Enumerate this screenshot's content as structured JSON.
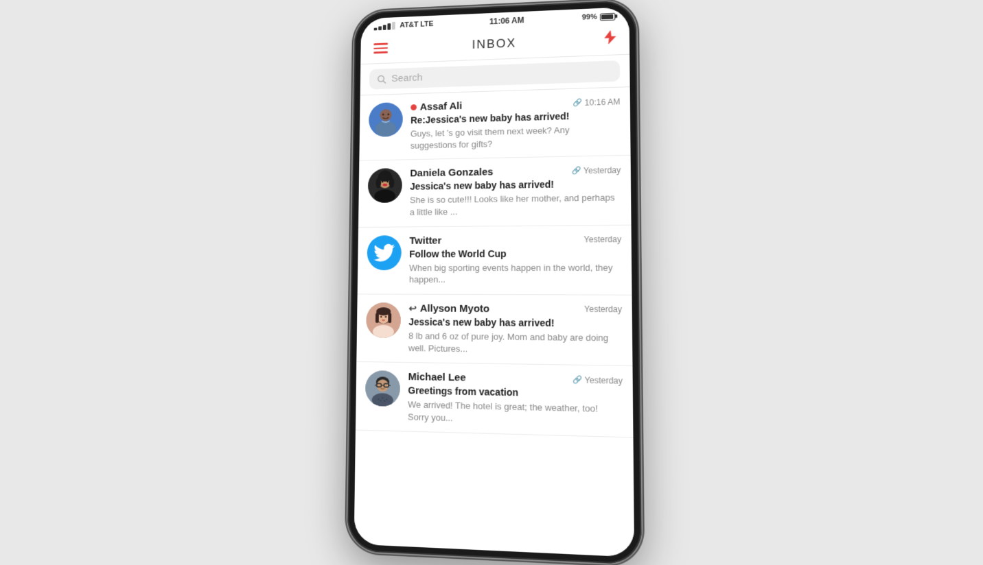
{
  "statusBar": {
    "carrier": "AT&T LTE",
    "time": "11:06 AM",
    "battery": "99%"
  },
  "header": {
    "title": "INBOX",
    "menuLabel": "Menu",
    "composeLabel": "Compose"
  },
  "search": {
    "placeholder": "Search"
  },
  "emails": [
    {
      "id": 1,
      "sender": "Assaf Ali",
      "unread": true,
      "time": "10:16 AM",
      "hasAttachment": true,
      "subject": "Re:Jessica's new baby has arrived!",
      "preview": "Guys, let 's go visit them next week? Any suggestions for gifts?",
      "avatarType": "assaf",
      "hasReply": false
    },
    {
      "id": 2,
      "sender": "Daniela Gonzales",
      "unread": false,
      "time": "Yesterday",
      "hasAttachment": true,
      "subject": "Jessica's new baby has arrived!",
      "preview": "She is so cute!!! Looks like her mother, and perhaps a little like ...",
      "avatarType": "daniela",
      "hasReply": false
    },
    {
      "id": 3,
      "sender": "Twitter",
      "unread": false,
      "time": "Yesterday",
      "hasAttachment": false,
      "subject": "Follow the World Cup",
      "preview": "When big sporting events happen in the world, they happen...",
      "avatarType": "twitter",
      "hasReply": false
    },
    {
      "id": 4,
      "sender": "Allyson Myoto",
      "unread": false,
      "time": "Yesterday",
      "hasAttachment": false,
      "subject": "Jessica's new baby has arrived!",
      "preview": "8 lb and 6 oz of pure joy. Mom and baby are doing well. Pictures...",
      "avatarType": "allyson",
      "hasReply": true
    },
    {
      "id": 5,
      "sender": "Michael Lee",
      "unread": false,
      "time": "Yesterday",
      "hasAttachment": true,
      "subject": "Greetings from vacation",
      "preview": "We arrived! The hotel is great; the weather, too! Sorry you...",
      "avatarType": "michael",
      "hasReply": false
    }
  ]
}
